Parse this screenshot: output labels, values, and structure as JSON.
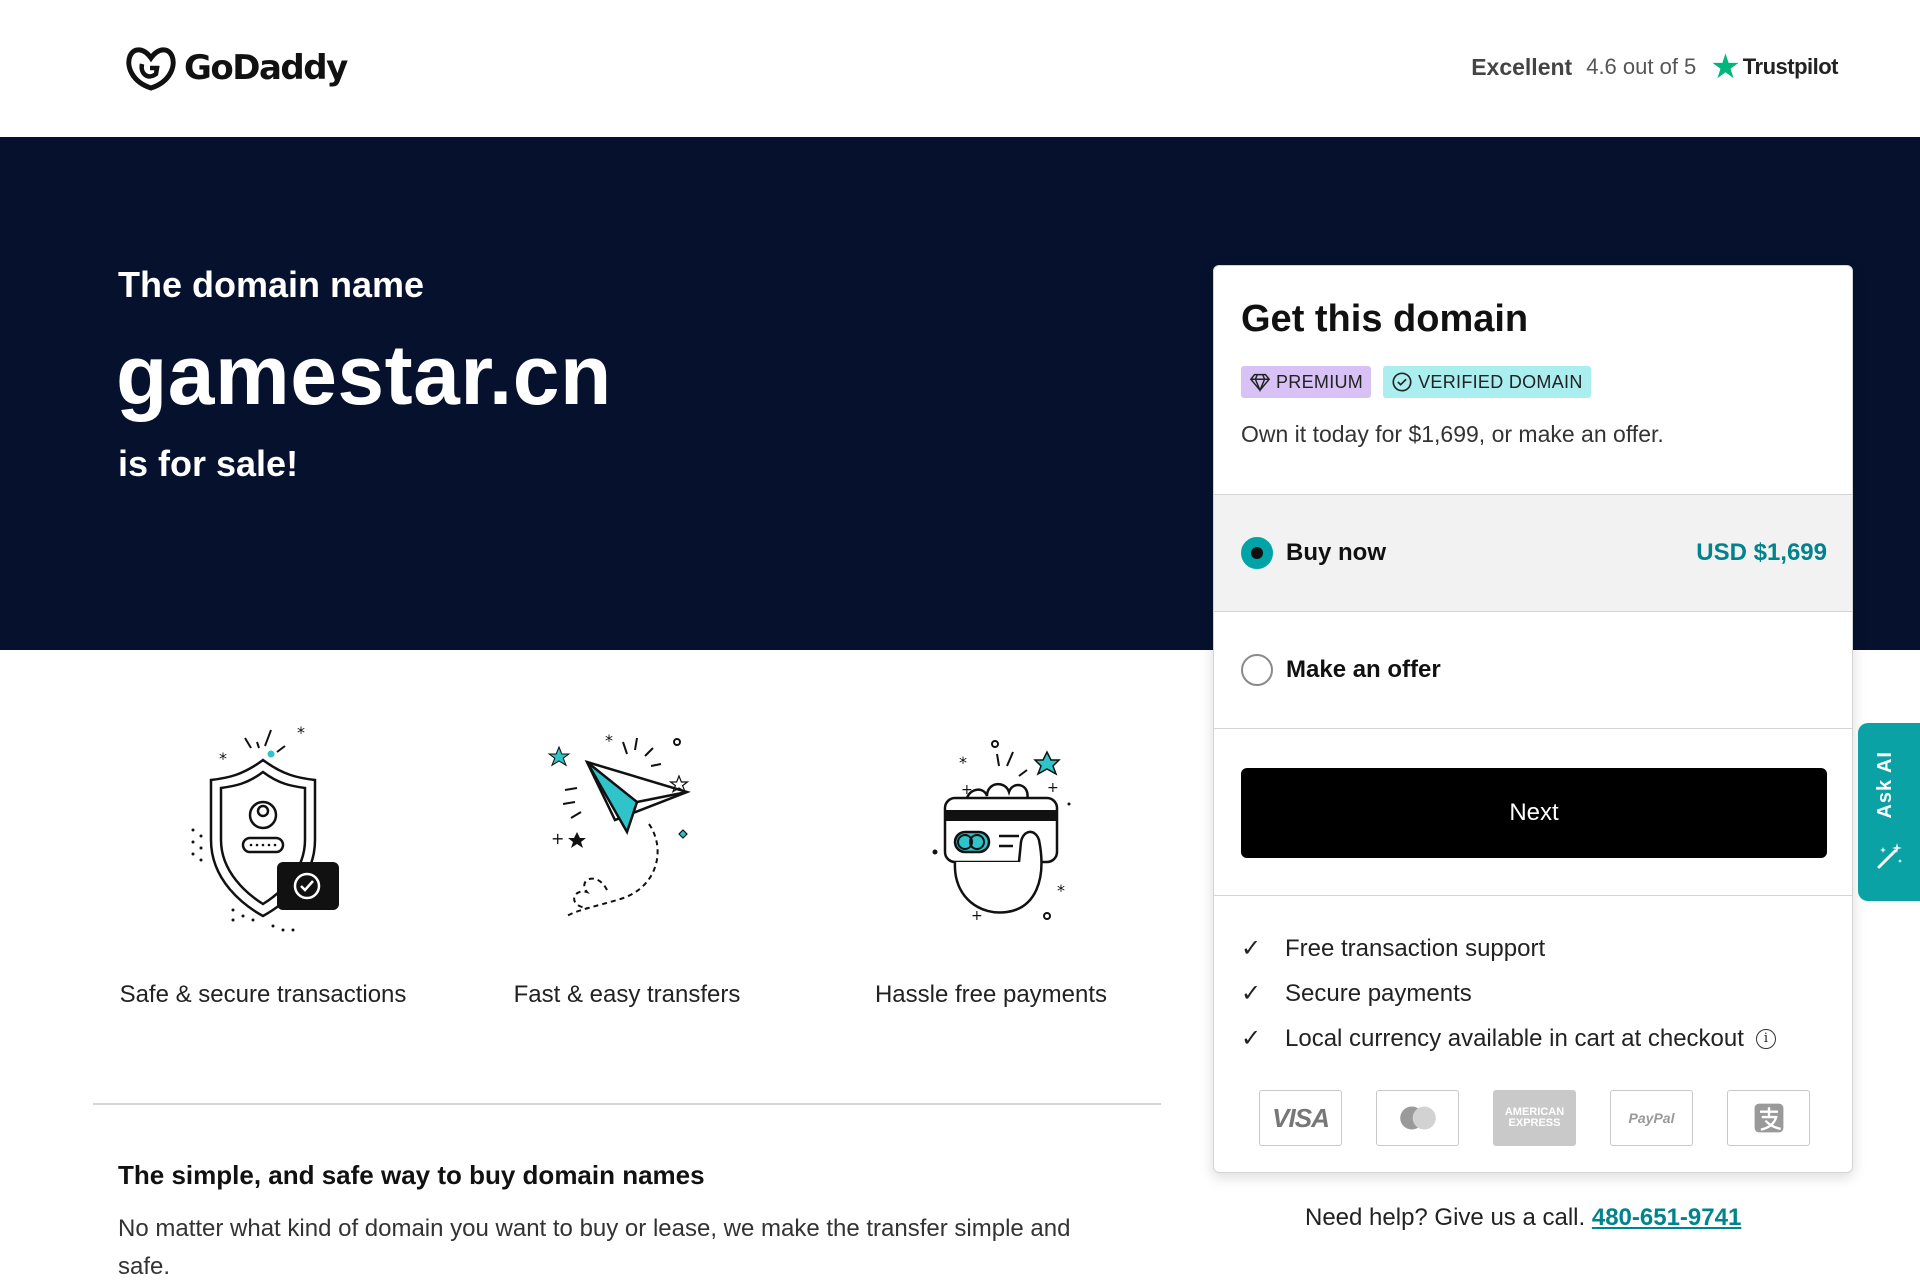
{
  "header": {
    "logo_text": "GoDaddy",
    "rating_label": "Excellent",
    "rating_score": "4.6 out of 5",
    "rating_star": "★",
    "rating_provider": "Trustpilot"
  },
  "hero": {
    "pre_title": "The domain name",
    "domain": "gamestar.cn",
    "post_title": "is for sale!"
  },
  "features": [
    {
      "icon": "secure-shield-icon",
      "label": "Safe & secure transactions"
    },
    {
      "icon": "paper-plane-icon",
      "label": "Fast & easy transfers"
    },
    {
      "icon": "payment-card-hand-icon",
      "label": "Hassle free payments"
    }
  ],
  "info": {
    "title": "The simple, and safe way to buy domain names",
    "text": "No matter what kind of domain you want to buy or lease, we make the transfer simple and safe."
  },
  "card": {
    "title": "Get this domain",
    "badge_premium": "PREMIUM",
    "badge_verified": "VERIFIED DOMAIN",
    "subtitle": "Own it today for $1,699, or make an offer.",
    "option_buy_label": "Buy now",
    "option_buy_price": "USD $1,699",
    "option_offer_label": "Make an offer",
    "next_label": "Next",
    "perks": [
      "Free transaction support",
      "Secure payments",
      "Local currency available in cart at checkout"
    ],
    "payment_methods": [
      "VISA",
      "mastercard-icon",
      "AMERICAN EXPRESS",
      "PayPal",
      "alipay-icon"
    ]
  },
  "help": {
    "text": "Need help? Give us a call.",
    "phone": "480-651-9741"
  },
  "askai": {
    "label": "Ask AI"
  },
  "colors": {
    "hero_bg": "#06122d",
    "accent_teal": "#00a4a6",
    "price_teal": "#00838c",
    "premium_badge": "#d8c2f5",
    "verified_badge": "#aaeef0",
    "askai_bg": "#0aa2a5",
    "trustpilot_green": "#00b67a"
  }
}
